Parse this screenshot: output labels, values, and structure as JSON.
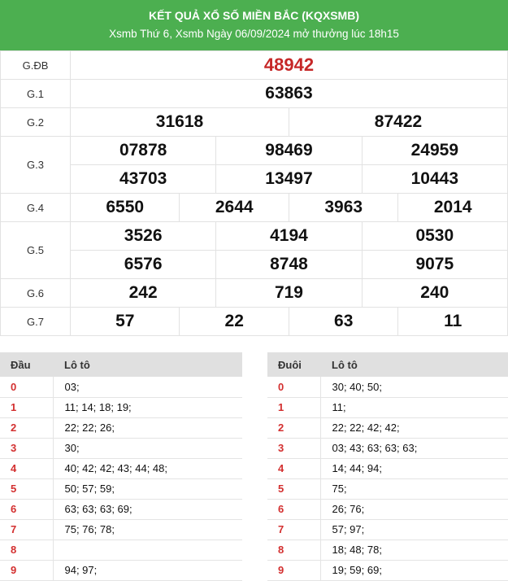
{
  "header": {
    "title": "KẾT QUẢ XỔ SỐ MIỀN BẮC (KQXSMB)",
    "subtitle": "Xsmb Thứ 6, Xsmb Ngày 06/09/2024 mở thưởng lúc 18h15"
  },
  "prizes": {
    "gdb": {
      "label": "G.ĐB",
      "numbers": [
        "48942"
      ]
    },
    "g1": {
      "label": "G.1",
      "numbers": [
        "63863"
      ]
    },
    "g2": {
      "label": "G.2",
      "numbers": [
        "31618",
        "87422"
      ]
    },
    "g3": {
      "label": "G.3",
      "numbers": [
        "07878",
        "98469",
        "24959",
        "43703",
        "13497",
        "10443"
      ]
    },
    "g4": {
      "label": "G.4",
      "numbers": [
        "6550",
        "2644",
        "3963",
        "2014"
      ]
    },
    "g5": {
      "label": "G.5",
      "numbers": [
        "3526",
        "4194",
        "0530",
        "6576",
        "8748",
        "9075"
      ]
    },
    "g6": {
      "label": "G.6",
      "numbers": [
        "242",
        "719",
        "240"
      ]
    },
    "g7": {
      "label": "G.7",
      "numbers": [
        "57",
        "22",
        "63",
        "11"
      ]
    }
  },
  "loto_head": {
    "col1": "Đầu",
    "col2": "Lô tô",
    "rows": [
      {
        "k": "0",
        "v": "03;"
      },
      {
        "k": "1",
        "v": "11; 14; 18; 19;"
      },
      {
        "k": "2",
        "v": "22; 22; 26;"
      },
      {
        "k": "3",
        "v": "30;"
      },
      {
        "k": "4",
        "v": "40; 42; 42; 43; 44; 48;"
      },
      {
        "k": "5",
        "v": "50; 57; 59;"
      },
      {
        "k": "6",
        "v": "63; 63; 63; 69;"
      },
      {
        "k": "7",
        "v": "75; 76; 78;"
      },
      {
        "k": "8",
        "v": ""
      },
      {
        "k": "9",
        "v": "94; 97;"
      }
    ]
  },
  "loto_tail": {
    "col1": "Đuôi",
    "col2": "Lô tô",
    "rows": [
      {
        "k": "0",
        "v": "30; 40; 50;"
      },
      {
        "k": "1",
        "v": "11;"
      },
      {
        "k": "2",
        "v": "22; 22; 42; 42;"
      },
      {
        "k": "3",
        "v": "03; 43; 63; 63; 63;"
      },
      {
        "k": "4",
        "v": "14; 44; 94;"
      },
      {
        "k": "5",
        "v": "75;"
      },
      {
        "k": "6",
        "v": "26; 76;"
      },
      {
        "k": "7",
        "v": "57; 97;"
      },
      {
        "k": "8",
        "v": "18; 48; 78;"
      },
      {
        "k": "9",
        "v": "19; 59; 69;"
      }
    ]
  }
}
